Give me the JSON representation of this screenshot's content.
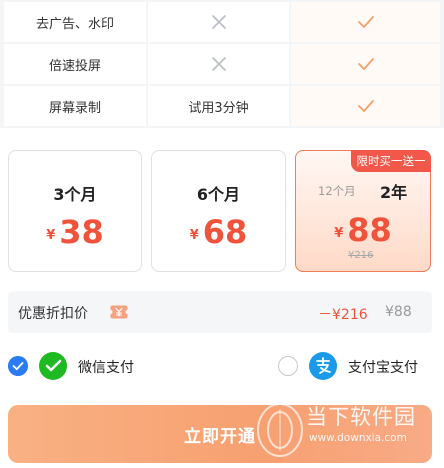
{
  "features": [
    {
      "name": "去广告、水印",
      "trial": "",
      "trial_icon": "cross-icon",
      "vip_icon": "check-icon"
    },
    {
      "name": "倍速投屏",
      "trial": "",
      "trial_icon": "cross-icon",
      "vip_icon": "check-icon"
    },
    {
      "name": "屏幕录制",
      "trial": "试用3分钟",
      "trial_icon": "",
      "vip_icon": "check-icon"
    }
  ],
  "plans": [
    {
      "title": "3个月",
      "currency": "¥",
      "price": "38"
    },
    {
      "title": "6个月",
      "currency": "¥",
      "price": "68"
    },
    {
      "badge": "限时买一送一",
      "term_label": "12个月",
      "title": "2年",
      "currency": "¥",
      "price": "88",
      "original_price": "¥216"
    }
  ],
  "discount": {
    "label": "优惠折扣价",
    "amount": "－¥216",
    "final": "¥88",
    "icon": "coupon-icon"
  },
  "payment": {
    "wechat": {
      "label": "微信支付",
      "selected": true,
      "icon": "wechat-pay-icon"
    },
    "alipay": {
      "label": "支付宝支付",
      "selected": false,
      "icon": "alipay-icon"
    }
  },
  "cta": {
    "label": "立即开通"
  },
  "watermark": {
    "name": "当下软件园",
    "url": "www.downxia.com"
  },
  "colors": {
    "accent_red": "#f0533c",
    "badge": "#f2584a",
    "radio_selected": "#2a7cf6",
    "wechat_green": "#1fb922",
    "alipay_blue": "#1a9ae8",
    "cta_orange": "#f7a071",
    "check_orange": "#f4a06a",
    "cross_gray": "#b8bcc4"
  }
}
